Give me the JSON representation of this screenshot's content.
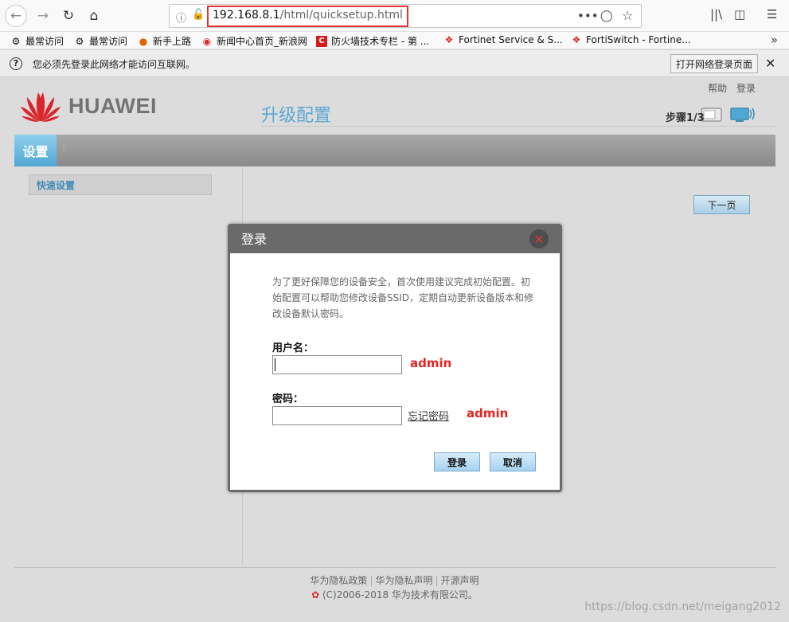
{
  "browser": {
    "url_host": "192.168.8.1",
    "url_path": "/html/quicksetup.html",
    "bookmarks": [
      {
        "label": "最常访问",
        "icon": "gear-icon"
      },
      {
        "label": "最常访问",
        "icon": "gear-icon"
      },
      {
        "label": "新手上路",
        "icon": "firefox-icon"
      },
      {
        "label": "新闻中心首页_新浪网",
        "icon": "weibo-icon"
      },
      {
        "label": "防火墙技术专栏 - 第 ...",
        "icon": "csdn-icon"
      },
      {
        "label": "Fortinet Service & S...",
        "icon": "fortinet-icon"
      },
      {
        "label": "FortiSwitch - Fortine...",
        "icon": "fortinet-icon"
      }
    ]
  },
  "notice": {
    "text": "您必须先登录此网络才能访问互联网。",
    "button": "打开网络登录页面"
  },
  "router": {
    "brand": "HUAWEI",
    "help": "帮助",
    "login": "登录",
    "menu_tab": "设置",
    "side_item": "快速设置",
    "title": "升级配置",
    "step": "步骤1/3",
    "next_button": "下一页",
    "footer_links": [
      "华为隐私政策",
      "华为隐私声明",
      "开源声明"
    ],
    "footer_copy": "(C)2006-2018 华为技术有限公司。"
  },
  "dialog": {
    "title": "登录",
    "description": "为了更好保障您的设备安全，首次使用建议完成初始配置。初始配置可以帮助您修改设备SSID，定期自动更新设备版本和修改设备默认密码。",
    "username_label": "用户名：",
    "password_label": "密码：",
    "forgot_link": "忘记密码",
    "login_button": "登录",
    "cancel_button": "取消",
    "annotation_user": "admin",
    "annotation_pass": "admin"
  },
  "watermark": "https://blog.csdn.net/meigang2012",
  "colors": {
    "accent": "#5aa8d4",
    "annotation": "#e82323",
    "huawei_red": "#d9262c"
  }
}
